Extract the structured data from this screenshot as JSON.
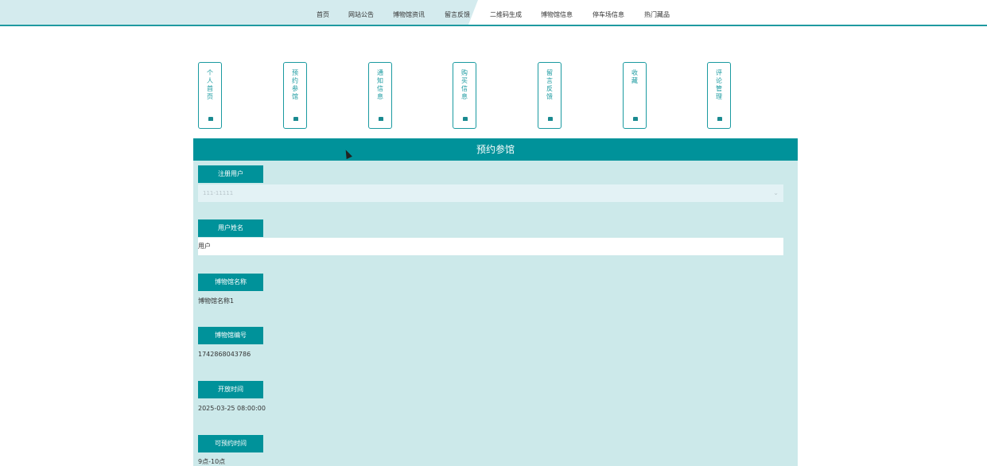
{
  "nav": {
    "items": [
      {
        "label": "首页"
      },
      {
        "label": "网站公告"
      },
      {
        "label": "博物馆资讯"
      },
      {
        "label": "留言反馈"
      },
      {
        "label": "二维码生成"
      },
      {
        "label": "博物馆信息"
      },
      {
        "label": "停车场信息"
      },
      {
        "label": "热门藏品"
      }
    ]
  },
  "menu": {
    "items": [
      {
        "label": "个人首页",
        "icon": "home-icon"
      },
      {
        "label": "预约参馆",
        "icon": "home-icon"
      },
      {
        "label": "通知信息",
        "icon": "home-icon"
      },
      {
        "label": "购买信息",
        "icon": "home-icon"
      },
      {
        "label": "留言反馈",
        "icon": "home-icon"
      },
      {
        "label": "收藏",
        "icon": "home-icon"
      },
      {
        "label": "评论管理",
        "icon": "home-icon"
      }
    ]
  },
  "panel": {
    "title": "预约参馆",
    "fields": [
      {
        "label": "注册用户",
        "value": "111-11111",
        "kind": "select"
      },
      {
        "label": "用户姓名",
        "value": "用户",
        "kind": "input"
      },
      {
        "label": "博物馆名称",
        "value": "博物馆名称1",
        "kind": "static"
      },
      {
        "label": "博物馆编号",
        "value": "1742868043786",
        "kind": "static"
      },
      {
        "label": "开放时间",
        "value": "2025-03-25 08:00:00",
        "kind": "static"
      },
      {
        "label": "可预约时间",
        "value": "9点-10点",
        "kind": "static"
      }
    ]
  },
  "colors": {
    "accent": "#00929a",
    "panel_bg": "#cce9ea"
  }
}
